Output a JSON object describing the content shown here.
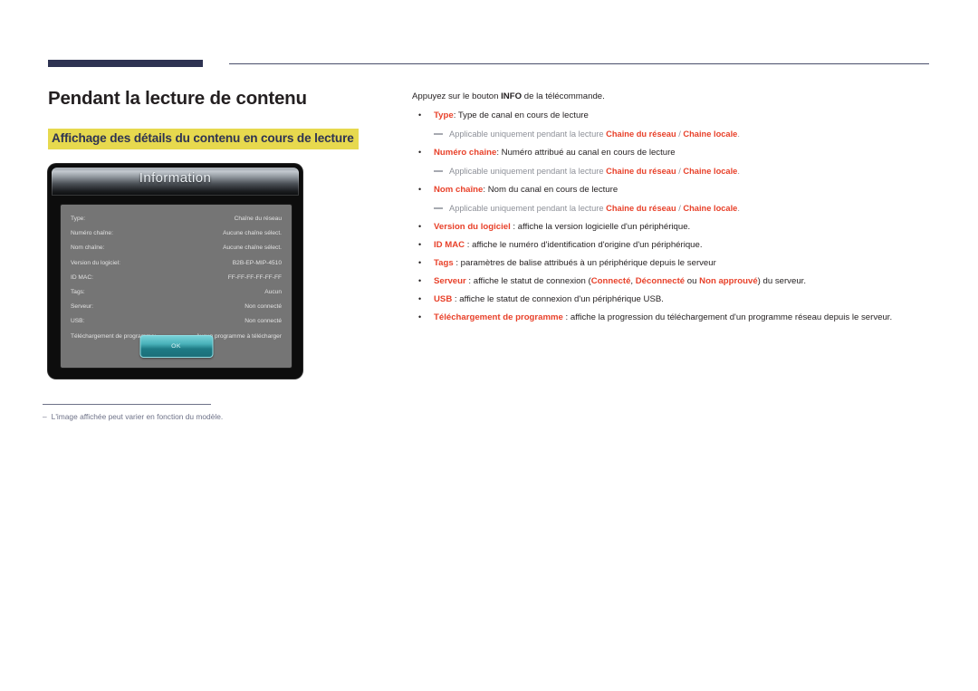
{
  "document": {
    "title": "Pendant la lecture de contenu",
    "subtitle": "Affichage des détails du contenu en cours de lecture"
  },
  "tv_dialog": {
    "title": "Information",
    "rows": [
      {
        "key": "Type:",
        "value": "Chaîne du réseau"
      },
      {
        "key": "Numéro chaîne:",
        "value": "Aucune chaîne sélect."
      },
      {
        "key": "Nom chaîne:",
        "value": "Aucune chaîne sélect."
      },
      {
        "key": "Version du logiciel:",
        "value": "B2B-EP-MIP-4510"
      },
      {
        "key": "ID MAC:",
        "value": "FF-FF-FF-FF-FF-FF"
      },
      {
        "key": "Tags:",
        "value": "Aucun"
      },
      {
        "key": "Serveur:",
        "value": "Non connecté"
      },
      {
        "key": "USB:",
        "value": "Non connecté"
      },
      {
        "key": "Téléchargement de programme:",
        "value": "Aucun programme à télécharger"
      }
    ],
    "ok_label": "OK"
  },
  "footnote": {
    "dash": "–",
    "text": "L'image affichée peut varier en fonction du modèle."
  },
  "right": {
    "intro_before": "Appuyez sur le bouton ",
    "intro_bold": "INFO",
    "intro_after": " de la télécommande.",
    "note_prefix": "Applicable uniquement pendant la lecture ",
    "note_channel_network": "Chaine du réseau",
    "note_separator": " / ",
    "note_channel_local": "Chaine locale",
    "note_suffix": ".",
    "items": [
      {
        "label": "Type",
        "text": ": Type de canal en cours de lecture"
      },
      {
        "label": "Numéro chaine",
        "text": ": Numéro attribué au canal en cours de lecture"
      },
      {
        "label": "Nom chaîne",
        "text": ": Nom du canal en cours de lecture"
      },
      {
        "label": "Version du logiciel",
        "text": " : affiche la version logicielle d'un périphérique."
      },
      {
        "label": "ID MAC",
        "text": " : affiche le numéro d'identification d'origine d'un périphérique."
      },
      {
        "label": "Tags",
        "text": " : paramètres de balise attribués à un périphérique depuis le serveur"
      },
      {
        "label": "USB",
        "text": " : affiche le statut de connexion d'un périphérique USB."
      },
      {
        "label": "Téléchargement de programme",
        "text": " : affiche la progression du téléchargement d'un programme réseau depuis le serveur."
      }
    ],
    "server_item": {
      "label": "Serveur",
      "part1": " : affiche le statut de connexion (",
      "status_connected": "Connecté",
      "comma": ", ",
      "status_disconnected": "Déconnecté",
      "or": " ou ",
      "status_unapproved": "Non approuvé",
      "part2": ") du serveur."
    }
  },
  "colors": {
    "accent_red": "#e8412a",
    "navy": "#2e3352",
    "highlight_yellow": "#e7d94e",
    "note_gray": "#8d9098"
  }
}
